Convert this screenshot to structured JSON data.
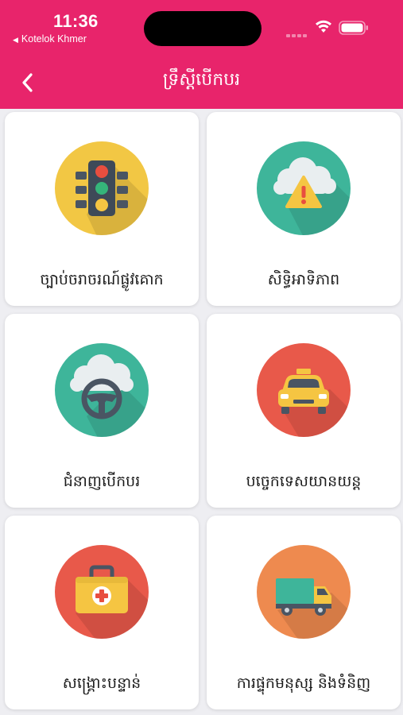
{
  "status_bar": {
    "time": "11:36",
    "back_app": "Kotelok Khmer"
  },
  "nav": {
    "title": "ទ្រឹស្ដីបើកបរ"
  },
  "cards": [
    {
      "label": "ច្បាប់ចរាចរណ៍ផ្លូវគោក",
      "icon": "traffic-light-icon",
      "color": "#f2c744"
    },
    {
      "label": "សិទ្ធិអាទិភាព",
      "icon": "cloud-warning-icon",
      "color": "#3eb59a"
    },
    {
      "label": "ជំនាញបើកបរ",
      "icon": "steering-wheel-icon",
      "color": "#3eb59a"
    },
    {
      "label": "បច្ចេកទេសយានយន្ត",
      "icon": "taxi-icon",
      "color": "#e8594a"
    },
    {
      "label": "សង្គ្រោះបន្ទាន់",
      "icon": "first-aid-kit-icon",
      "color": "#e8594a"
    },
    {
      "label": "ការផ្ទុកមនុស្ស និងទំនិញ",
      "icon": "truck-icon",
      "color": "#ee8a4f"
    }
  ]
}
